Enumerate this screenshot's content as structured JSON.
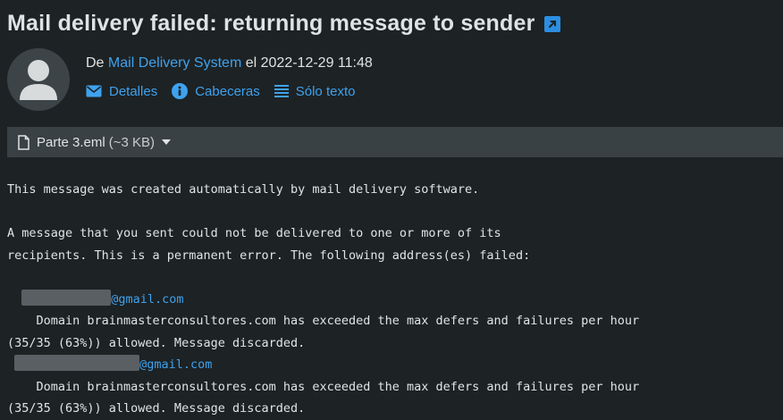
{
  "message": {
    "subject": "Mail delivery failed: returning message to sender",
    "from_prefix": "De",
    "sender": "Mail Delivery System",
    "date_prefix": "el",
    "date": "2022-12-29 11:48"
  },
  "actions": {
    "details": "Detalles",
    "headers": "Cabeceras",
    "plain_text": "Sólo texto"
  },
  "attachment": {
    "name": "Parte 3.eml",
    "size": "(~3 KB)"
  },
  "body": {
    "line1": "This message was created automatically by mail delivery software.",
    "line2": "A message that you sent could not be delivered to one or more of its",
    "line3": "recipients. This is a permanent error. The following address(es) failed:",
    "recipient1_domain": "@gmail.com",
    "error1_line1": "    Domain brainmasterconsultores.com has exceeded the max defers and failures per hour",
    "error1_line2": "(35/35 (63%)) allowed. Message discarded.",
    "recipient2_domain": "@gmail.com",
    "error2_line1": "    Domain brainmasterconsultores.com has exceeded the max defers and failures per hour",
    "error2_line2": "(35/35 (63%)) allowed. Message discarded."
  },
  "colors": {
    "background": "#1d2224",
    "link": "#3ea2ee",
    "attachment_bar": "#394144"
  },
  "icons": {
    "external": "external-link-icon",
    "avatar": "user-avatar-icon",
    "details": "envelope-icon",
    "headers": "info-icon",
    "plain_text": "lines-icon",
    "file": "file-icon",
    "caret": "caret-down-icon"
  }
}
